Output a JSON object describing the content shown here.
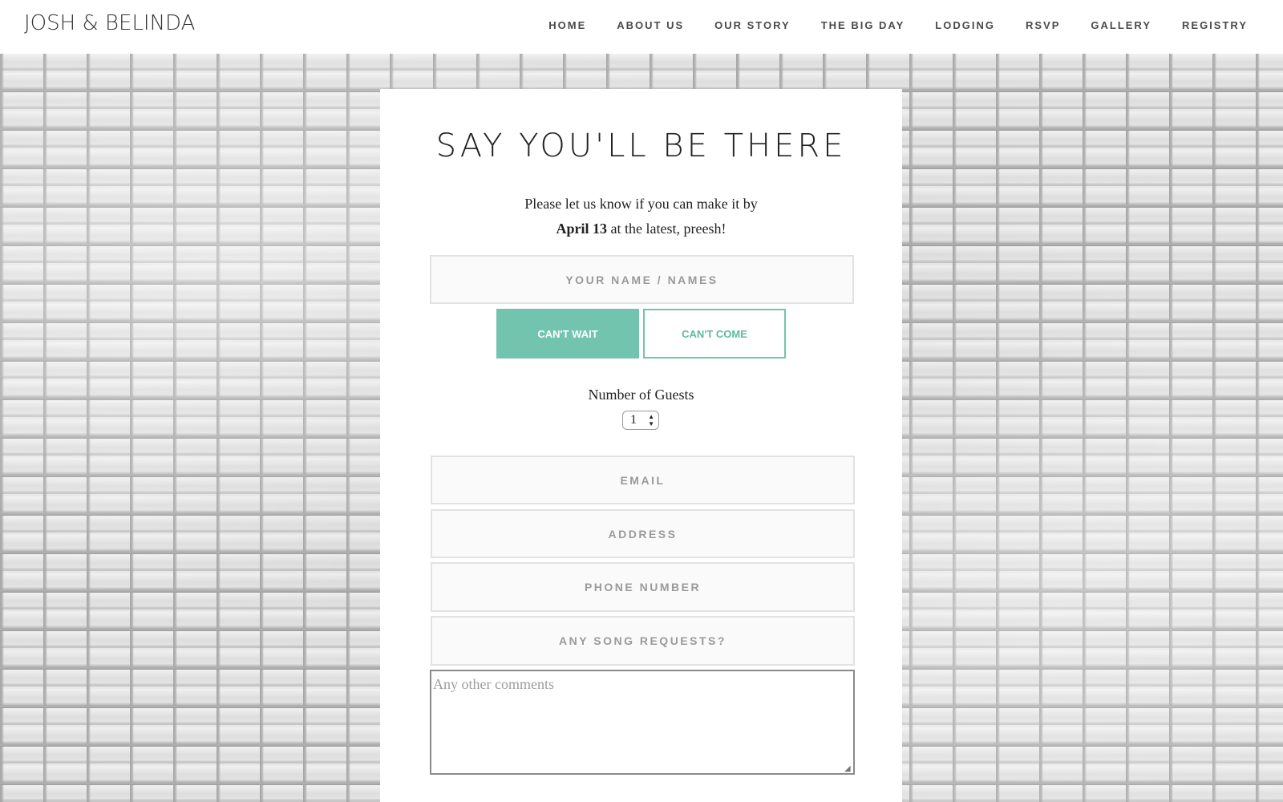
{
  "header": {
    "brand": "JOSH & BELINDA",
    "nav": [
      "HOME",
      "ABOUT US",
      "OUR STORY",
      "THE BIG DAY",
      "LODGING",
      "RSVP",
      "GALLERY",
      "REGISTRY"
    ]
  },
  "rsvp": {
    "title": "SAY YOU'LL BE THERE",
    "intro_line1": "Please let us know if you can make it by",
    "intro_date": "April 13",
    "intro_line2_rest": " at the latest, preesh!",
    "name_placeholder": "YOUR NAME / NAMES",
    "accept_label": "CAN'T WAIT",
    "decline_label": "CAN'T COME",
    "guests_label": "Number of Guests",
    "guests_value": "1",
    "email_placeholder": "EMAIL",
    "address_placeholder": "ADDRESS",
    "phone_placeholder": "PHONE NUMBER",
    "song_placeholder": "ANY SONG REQUESTS?",
    "comments_placeholder": "Any other comments"
  },
  "colors": {
    "accent": "#72c4ae",
    "background": "#ffffff",
    "text": "#222222"
  }
}
